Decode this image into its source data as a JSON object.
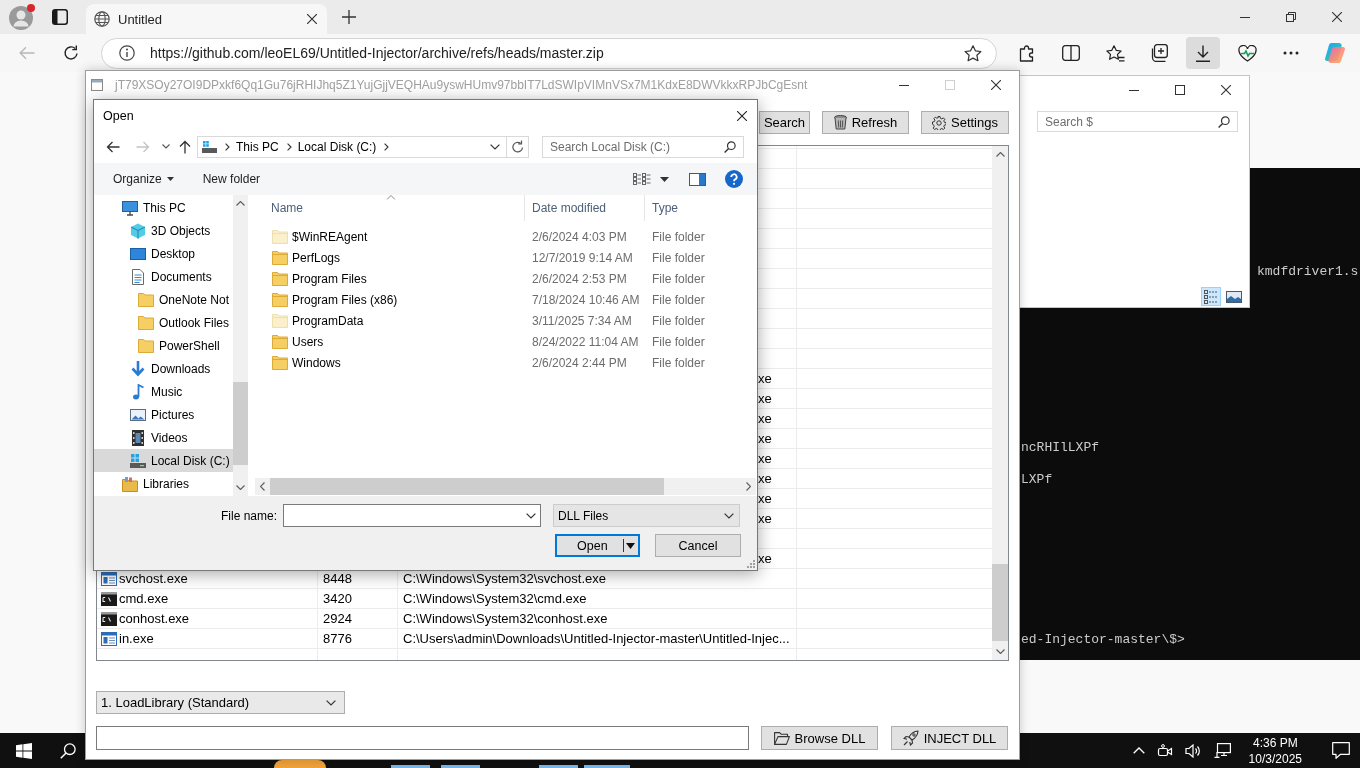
{
  "browser": {
    "tab": {
      "title": "Untitled",
      "selected": true
    },
    "nav": [
      {
        "kind": "back",
        "disabled": true
      },
      {
        "kind": "refresh",
        "disabled": false
      }
    ],
    "url": "https://github.com/leoEL69/Untitled-Injector/archive/refs/heads/master.zip",
    "toolbar": [
      {
        "kind": "extensions",
        "selected": false
      },
      {
        "kind": "split-screen",
        "selected": false
      },
      {
        "kind": "favorites",
        "selected": false
      },
      {
        "kind": "collections",
        "selected": false
      },
      {
        "kind": "downloads",
        "selected": true
      },
      {
        "kind": "performance",
        "selected": false
      },
      {
        "kind": "more",
        "selected": false
      },
      {
        "kind": "copilot",
        "selected": false
      }
    ]
  },
  "terminal": {
    "lines": [
      "kmdfdriver1.s",
      "ncRHIlLXPf",
      "LXPf",
      "ed-Injector-master\\$>"
    ]
  },
  "explorer": {
    "search": {
      "placeholder": "Search $"
    },
    "views": [
      {
        "kind": "details",
        "selected": true
      },
      {
        "kind": "large-icons",
        "selected": false
      }
    ]
  },
  "injector": {
    "title": "jT79XSOy27OI9DPxkf6Qq1Gu76jRHIJhq5Z1YujGjjVEQHAu9yswHUmv97bbIT7LdSWIpVIMnVSx7M1KdxE8DWVkkxRPJbCgEsnt",
    "active": false,
    "window_buttons": [
      {
        "kind": "minimize",
        "disabled": false
      },
      {
        "kind": "maximize",
        "disabled": true
      },
      {
        "kind": "close",
        "disabled": false
      }
    ],
    "toolbar": [
      {
        "label": "Search",
        "kind": "plain"
      },
      {
        "label": "Refresh",
        "kind": "bin"
      },
      {
        "label": "Settings",
        "kind": "gear"
      }
    ],
    "process_table": {
      "covered_rows": [
        {
          "kind": "blank"
        },
        {
          "kind": "blank"
        },
        {
          "kind": "blank"
        },
        {
          "kind": "blank"
        },
        {
          "kind": "blank"
        },
        {
          "kind": "blank"
        },
        {
          "kind": "blank"
        },
        {
          "kind": "blank"
        },
        {
          "kind": "blank"
        },
        {
          "kind": "blank"
        },
        {
          "kind": "blank"
        },
        {
          "kind": "path-end",
          "text": "xe"
        },
        {
          "kind": "path-end",
          "text": "xe"
        },
        {
          "kind": "path-end",
          "text": "xe"
        },
        {
          "kind": "path-end",
          "text": "xe"
        },
        {
          "kind": "path-end",
          "text": "xe"
        },
        {
          "kind": "path-end",
          "text": "xe"
        },
        {
          "kind": "path-end",
          "text": "xe"
        },
        {
          "kind": "path-end",
          "text": "xe"
        },
        {
          "kind": "blank"
        },
        {
          "kind": "path-end",
          "text": "xe"
        }
      ],
      "rows": [
        {
          "kind": "window",
          "name": "svchost.exe",
          "pid": "8448",
          "path": "C:\\Windows\\System32\\svchost.exe"
        },
        {
          "kind": "console",
          "name": "cmd.exe",
          "pid": "3420",
          "path": "C:\\Windows\\System32\\cmd.exe"
        },
        {
          "kind": "console",
          "name": "conhost.exe",
          "pid": "2924",
          "path": "C:\\Windows\\System32\\conhost.exe"
        },
        {
          "kind": "window",
          "name": "in.exe",
          "pid": "8776",
          "path": "C:\\Users\\admin\\Downloads\\Untitled-Injector-master\\Untitled-Injec..."
        }
      ]
    },
    "method": {
      "value": "1. LoadLibrary (Standard)"
    },
    "buttons": [
      {
        "label": "Browse DLL",
        "kind": "folder"
      },
      {
        "label": "INJECT DLL",
        "kind": "rocket"
      }
    ]
  },
  "open_dialog": {
    "title": "Open",
    "nav_buttons": [
      {
        "kind": "back",
        "disabled": false
      },
      {
        "kind": "forward",
        "disabled": true
      },
      {
        "kind": "recent",
        "disabled": false
      },
      {
        "kind": "up",
        "disabled": false
      }
    ],
    "breadcrumb": [
      "This PC",
      "Local Disk (C:)"
    ],
    "search": {
      "placeholder": "Search Local Disk (C:)"
    },
    "commands": [
      {
        "label": "Organize",
        "kind": "menu"
      },
      {
        "label": "New folder",
        "kind": "plain"
      }
    ],
    "nav_pane": [
      {
        "label": "This PC",
        "kind": "pc",
        "selected": false,
        "children": [
          {
            "label": "3D Objects",
            "kind": "cube",
            "selected": false
          },
          {
            "label": "Desktop",
            "kind": "desktop",
            "selected": false
          },
          {
            "label": "Documents",
            "kind": "document",
            "selected": false,
            "children": [
              {
                "label": "OneNote Not",
                "kind": "folder",
                "selected": false
              },
              {
                "label": "Outlook Files",
                "kind": "folder",
                "selected": false
              },
              {
                "label": "PowerShell",
                "kind": "folder",
                "selected": false
              }
            ]
          },
          {
            "label": "Downloads",
            "kind": "download",
            "selected": false
          },
          {
            "label": "Music",
            "kind": "music",
            "selected": false
          },
          {
            "label": "Pictures",
            "kind": "picture",
            "selected": false
          },
          {
            "label": "Videos",
            "kind": "video",
            "selected": false
          },
          {
            "label": "Local Disk (C:)",
            "kind": "drive",
            "selected": true
          }
        ]
      },
      {
        "label": "Libraries",
        "kind": "library",
        "selected": false
      }
    ],
    "columns": [
      {
        "label": "Name",
        "sorted": true
      },
      {
        "label": "Date modified",
        "sorted": false
      },
      {
        "label": "Type",
        "sorted": false
      }
    ],
    "files": [
      {
        "name": "$WinREAgent",
        "date": "2/6/2024 4:03 PM",
        "type": "File folder",
        "hidden": true
      },
      {
        "name": "PerfLogs",
        "date": "12/7/2019 9:14 AM",
        "type": "File folder",
        "hidden": false
      },
      {
        "name": "Program Files",
        "date": "2/6/2024 2:53 PM",
        "type": "File folder",
        "hidden": false
      },
      {
        "name": "Program Files (x86)",
        "date": "7/18/2024 10:46 AM",
        "type": "File folder",
        "hidden": false
      },
      {
        "name": "ProgramData",
        "date": "3/11/2025 7:34 AM",
        "type": "File folder",
        "hidden": true
      },
      {
        "name": "Users",
        "date": "8/24/2022 11:04 AM",
        "type": "File folder",
        "hidden": false
      },
      {
        "name": "Windows",
        "date": "2/6/2024 2:44 PM",
        "type": "File folder",
        "hidden": false
      }
    ],
    "file_name": {
      "label": "File name:"
    },
    "file_type": {
      "value": "DLL Files"
    },
    "buttons": [
      {
        "label": "Open",
        "kind": "split",
        "default": true
      },
      {
        "label": "Cancel",
        "kind": "plain",
        "default": false
      }
    ]
  },
  "taskbar": {
    "apps": [
      {
        "running": true
      },
      {
        "running": true
      },
      {
        "running": true
      },
      {
        "running": true
      }
    ],
    "time": "4:36 PM",
    "date": "10/3/2025"
  }
}
